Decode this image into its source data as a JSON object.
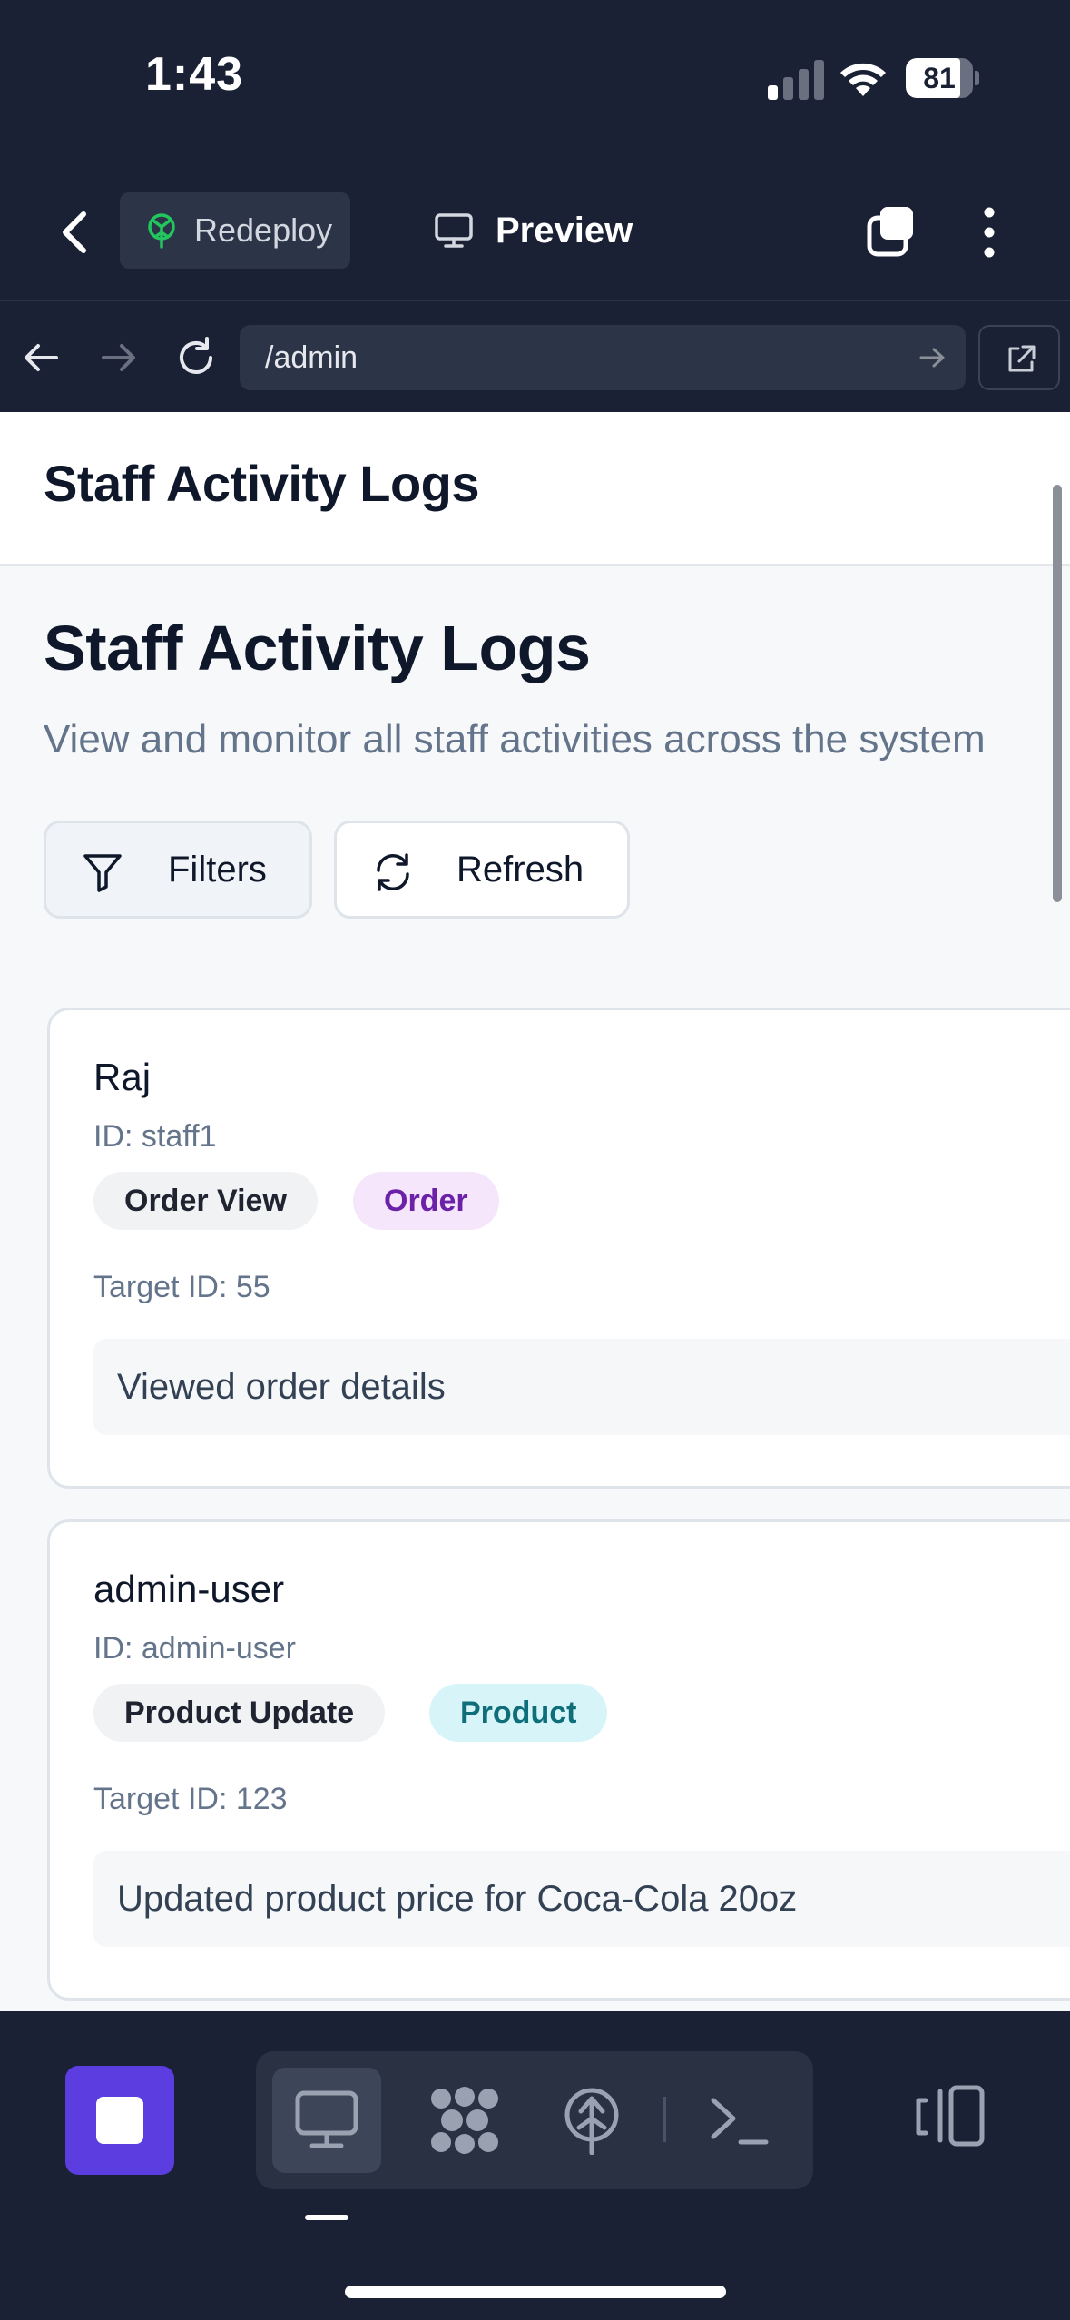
{
  "status_bar": {
    "time": "1:43",
    "battery_percent": "81",
    "battery_level": 0.81
  },
  "app_header": {
    "redeploy_label": "Redeploy",
    "preview_label": "Preview"
  },
  "browser": {
    "url": "/admin"
  },
  "page": {
    "topbar_title": "Staff Activity Logs",
    "heading": "Staff Activity Logs",
    "subtitle": "View and monitor all staff activities across the system",
    "filters_label": "Filters",
    "refresh_label": "Refresh"
  },
  "logs": [
    {
      "name": "Raj",
      "id": "ID: staff1",
      "action": "Order View",
      "category": "Order",
      "category_bg": "#f5e6fb",
      "category_fg": "#6b21a8",
      "target": "Target ID: 55",
      "details": "Viewed order details"
    },
    {
      "name": "admin-user",
      "id": "ID: admin-user",
      "action": "Product Update",
      "category": "Product",
      "category_bg": "#d7f5f8",
      "category_fg": "#0e6e7a",
      "target": "Target ID: 123",
      "details": "Updated product price for Coca-Cola 20oz"
    }
  ],
  "toolbar": {
    "icons": [
      "stop-icon",
      "monitor-icon",
      "shapes-icon",
      "deploy-icon",
      "terminal-icon",
      "layout-toggle-icon"
    ]
  },
  "colors": {
    "chrome_bg": "#1b2135",
    "accent_purple": "#5b3de0",
    "page_bg": "#f6f8fa",
    "text_dark": "#0f172a",
    "text_muted": "#64748b"
  }
}
